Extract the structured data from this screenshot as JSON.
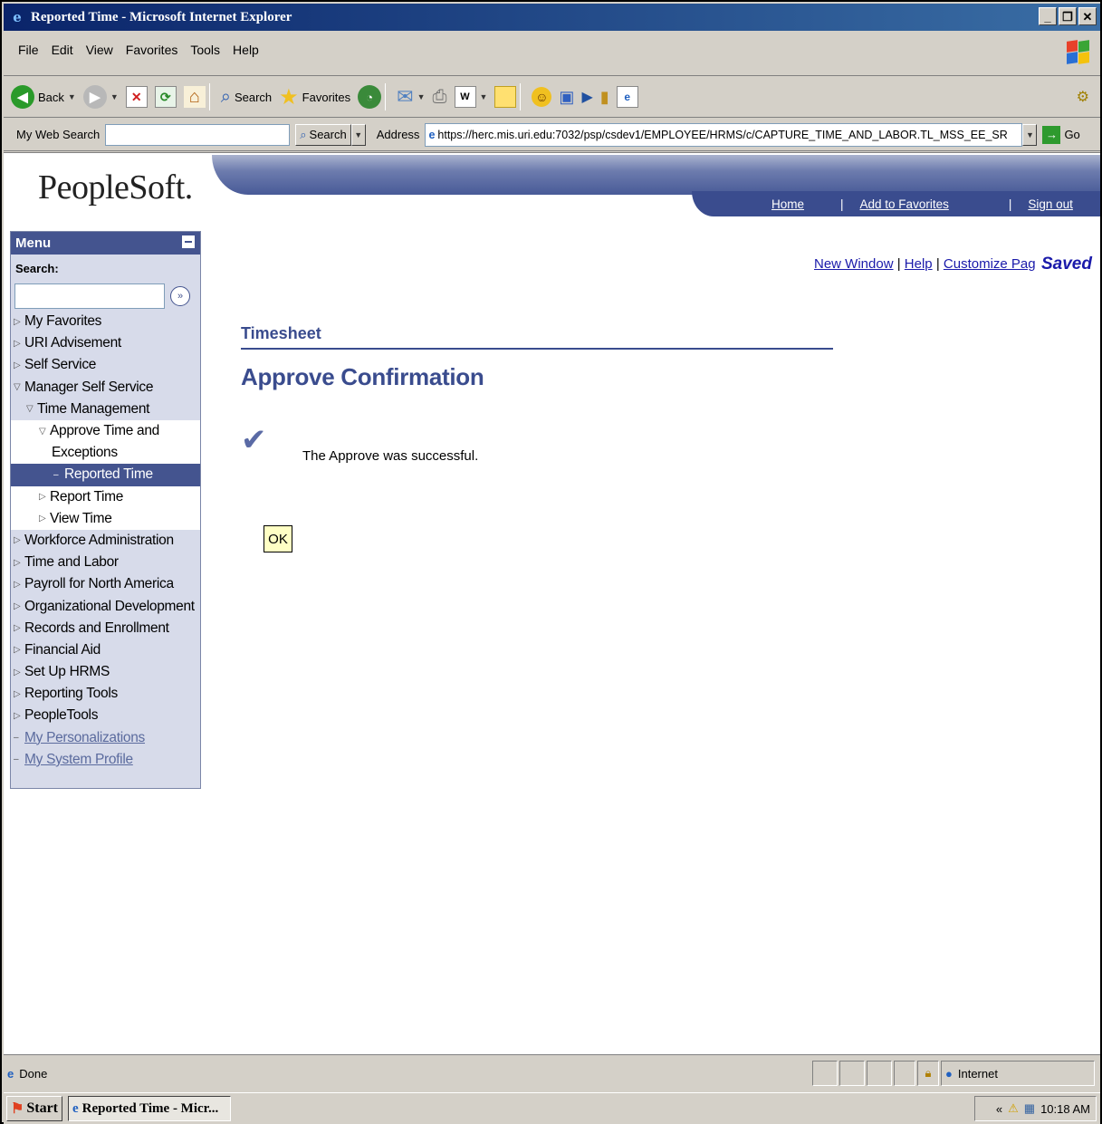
{
  "window": {
    "title": "Reported Time - Microsoft Internet Explorer"
  },
  "menubar": {
    "items": [
      "File",
      "Edit",
      "View",
      "Favorites",
      "Tools",
      "Help"
    ]
  },
  "toolbar": {
    "back_label": "Back",
    "search_label": "Search",
    "favorites_label": "Favorites"
  },
  "addressbar": {
    "my_web_search_label": "My Web Search",
    "search_button": "Search",
    "address_label": "Address",
    "url": "https://herc.mis.uri.edu:7032/psp/csdev1/EMPLOYEE/HRMS/c/CAPTURE_TIME_AND_LABOR.TL_MSS_EE_SR",
    "go_label": "Go"
  },
  "header": {
    "logo": "PeopleSoft.",
    "links": {
      "home": "Home",
      "favorites": "Add to Favorites",
      "signout": "Sign out"
    }
  },
  "sidebar": {
    "title": "Menu",
    "search_label": "Search:",
    "items": [
      {
        "label": "My Favorites",
        "indent": 0,
        "state": "collapsed"
      },
      {
        "label": "URI Advisement",
        "indent": 0,
        "state": "collapsed"
      },
      {
        "label": "Self Service",
        "indent": 0,
        "state": "collapsed"
      },
      {
        "label": "Manager Self Service",
        "indent": 0,
        "state": "expanded"
      },
      {
        "label": "Time Management",
        "indent": 1,
        "state": "expanded"
      },
      {
        "label": "Approve Time and",
        "indent": 2,
        "state": "expanded"
      },
      {
        "label": "Exceptions",
        "indent": 2,
        "state": "cont"
      },
      {
        "label": "Reported Time",
        "indent": 2,
        "state": "selected"
      },
      {
        "label": "Report Time",
        "indent": 2,
        "state": "collapsed"
      },
      {
        "label": "View Time",
        "indent": 2,
        "state": "collapsed"
      },
      {
        "label": "Workforce Administration",
        "indent": 0,
        "state": "collapsed"
      },
      {
        "label": "Time and Labor",
        "indent": 0,
        "state": "collapsed"
      },
      {
        "label": "Payroll for North America",
        "indent": 0,
        "state": "collapsed"
      },
      {
        "label": "Organizational Development",
        "indent": 0,
        "state": "collapsed"
      },
      {
        "label": "Records and Enrollment",
        "indent": 0,
        "state": "collapsed"
      },
      {
        "label": "Financial Aid",
        "indent": 0,
        "state": "collapsed"
      },
      {
        "label": "Set Up HRMS",
        "indent": 0,
        "state": "collapsed"
      },
      {
        "label": "Reporting Tools",
        "indent": 0,
        "state": "collapsed"
      },
      {
        "label": "PeopleTools",
        "indent": 0,
        "state": "collapsed"
      },
      {
        "label": "My Personalizations",
        "indent": 0,
        "state": "link"
      },
      {
        "label": "My System Profile",
        "indent": 0,
        "state": "link"
      }
    ]
  },
  "content": {
    "utility": {
      "new_window": "New Window",
      "help": "Help",
      "customize": "Customize Pag",
      "sep": "|"
    },
    "saved": "Saved",
    "section": "Timesheet",
    "title": "Approve Confirmation",
    "message": "The Approve was successful.",
    "ok_label": "OK"
  },
  "statusbar": {
    "status": "Done",
    "zone": "Internet"
  },
  "taskbar": {
    "start": "Start",
    "task": "Reported Time - Micr...",
    "time": "10:18 AM"
  }
}
